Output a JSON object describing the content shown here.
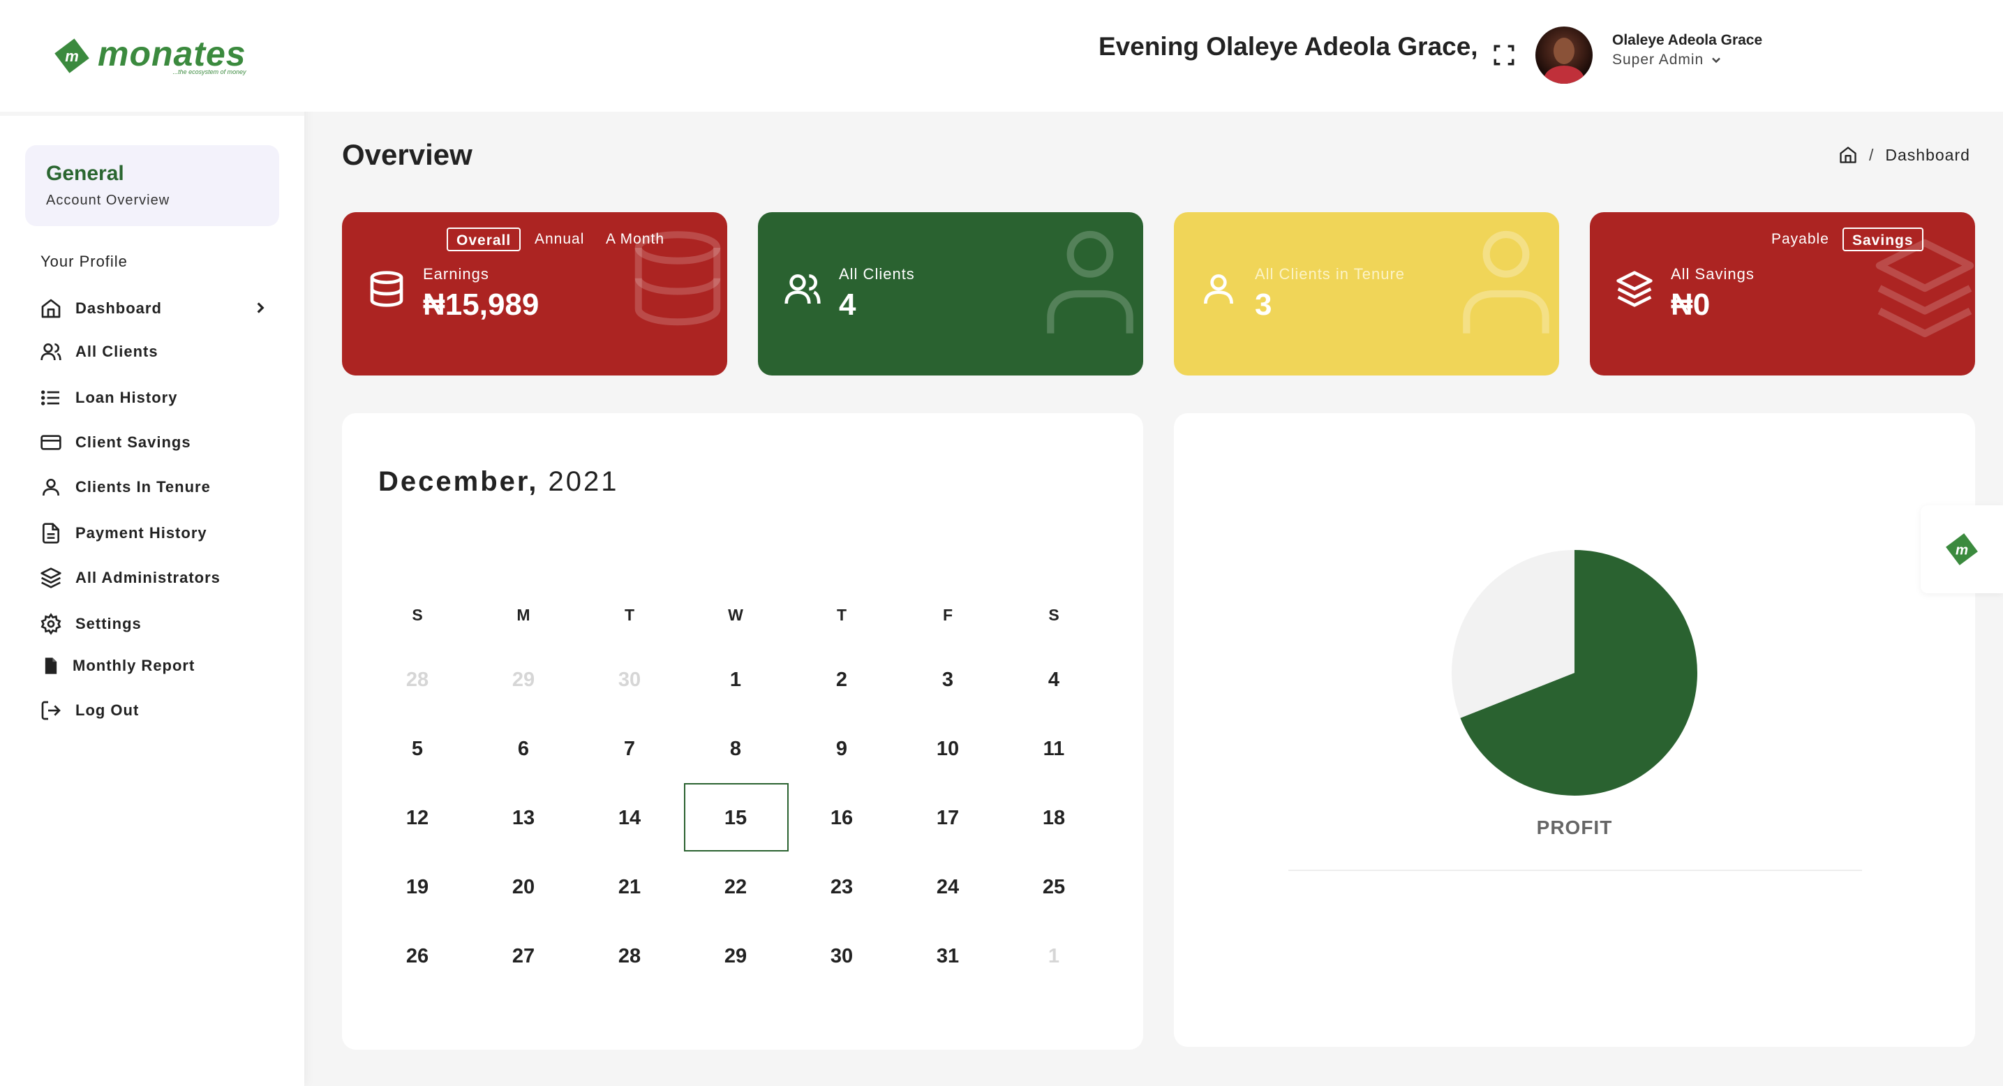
{
  "brand": {
    "name": "monates",
    "tagline": "...the ecosystem of money",
    "accent": "#2a6230",
    "red": "#ac2422",
    "yellow": "#f0d558"
  },
  "header": {
    "greeting": "Evening Olaleye Adeola Grace,",
    "user_name": "Olaleye Adeola Grace",
    "user_role": "Super Admin"
  },
  "sidebar": {
    "general_title": "General",
    "general_sub": "Account Overview",
    "profile_label": "Your Profile",
    "items": [
      {
        "label": "Dashboard",
        "icon": "home-icon"
      },
      {
        "label": "All Clients",
        "icon": "users-icon"
      },
      {
        "label": "Loan History",
        "icon": "list-icon"
      },
      {
        "label": "Client Savings",
        "icon": "credit-card-icon"
      },
      {
        "label": "Clients In Tenure",
        "icon": "user-icon"
      },
      {
        "label": "Payment History",
        "icon": "file-text-icon"
      },
      {
        "label": "All Administrators",
        "icon": "layers-icon"
      },
      {
        "label": "Settings",
        "icon": "gear-icon"
      },
      {
        "label": "Monthly Report",
        "icon": "file-icon"
      },
      {
        "label": "Log Out",
        "icon": "logout-icon"
      }
    ]
  },
  "page": {
    "title": "Overview",
    "breadcrumb_current": "Dashboard"
  },
  "cards": {
    "earnings": {
      "tabs": [
        "Overall",
        "Annual",
        "A Month"
      ],
      "active_tab": "Overall",
      "label": "Earnings",
      "value": "₦15,989"
    },
    "clients": {
      "label": "All Clients",
      "value": "4"
    },
    "tenure": {
      "label": "All Clients in Tenure",
      "value": "3"
    },
    "savings": {
      "tabs": [
        "Payable",
        "Savings"
      ],
      "active_tab": "Savings",
      "label": "All Savings",
      "value": "₦0"
    }
  },
  "calendar": {
    "month": "December,",
    "year": "2021",
    "weekdays": [
      "S",
      "M",
      "T",
      "W",
      "T",
      "F",
      "S"
    ],
    "weeks": [
      [
        "28",
        "29",
        "30",
        "1",
        "2",
        "3",
        "4"
      ],
      [
        "5",
        "6",
        "7",
        "8",
        "9",
        "10",
        "11"
      ],
      [
        "12",
        "13",
        "14",
        "15",
        "16",
        "17",
        "18"
      ],
      [
        "19",
        "20",
        "21",
        "22",
        "23",
        "24",
        "25"
      ],
      [
        "26",
        "27",
        "28",
        "29",
        "30",
        "31",
        "1"
      ]
    ],
    "selected": "15"
  },
  "chart_data": {
    "type": "pie",
    "title": "PROFIT",
    "slices": [
      {
        "fraction": 0.69,
        "color": "#2a6230"
      },
      {
        "fraction": 0.31,
        "color": "#f2f2f2"
      }
    ]
  }
}
